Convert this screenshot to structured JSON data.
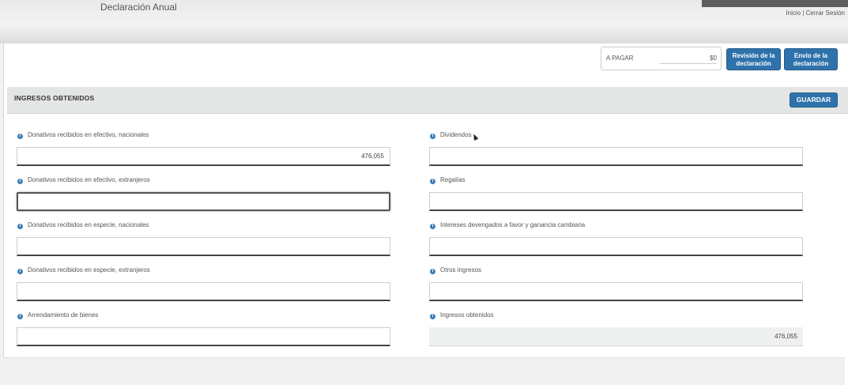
{
  "header": {
    "app_title": "Declaración Anual",
    "links": {
      "home": "Inicio",
      "separator": "|",
      "logout": "Cerrar Sesión"
    }
  },
  "summary": {
    "pay_label": "A PAGAR",
    "pay_value": "$0",
    "review_button": "Revisión de la declaración",
    "send_button": "Envío de la declaración"
  },
  "section": {
    "title": "INGRESOS OBTENIDOS",
    "save_button": "GUARDAR"
  },
  "left_fields": [
    {
      "label": "Donativos recibidos en efectivo, nacionales",
      "value": "476,055"
    },
    {
      "label": "Donativos recibidos en efectivo, extranjeros",
      "value": ""
    },
    {
      "label": "Donativos recibidos en especie, nacionales",
      "value": ""
    },
    {
      "label": "Donativos recibidos en especie, extranjeros",
      "value": ""
    },
    {
      "label": "Arrendamiento de bienes",
      "value": ""
    }
  ],
  "right_fields": [
    {
      "label": "Dividendos",
      "value": ""
    },
    {
      "label": "Regalías",
      "value": ""
    },
    {
      "label": "Intereses devengados a favor y ganancia cambiaria",
      "value": ""
    },
    {
      "label": "Otros ingresos",
      "value": ""
    },
    {
      "label": "Ingresos obtenidos",
      "value": "476,055"
    }
  ],
  "icons": {
    "info": "info-icon",
    "cursor": "mouse-pointer-icon"
  },
  "colors": {
    "primary_button": "#2f72ab",
    "section_bar": "#e3e6e4"
  }
}
